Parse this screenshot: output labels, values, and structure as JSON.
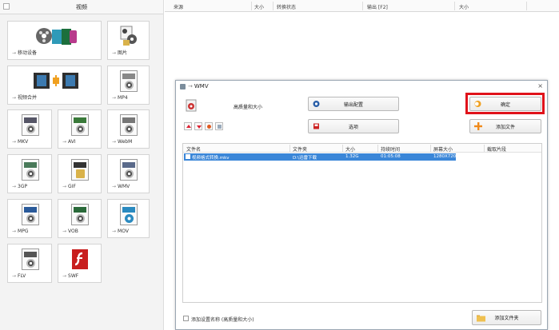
{
  "sidebar": {
    "header": "视频",
    "tiles": [
      {
        "label": "移动设备",
        "icon": "mobile-device-icon"
      },
      {
        "label": "图片",
        "icon": "picture-icon"
      },
      {
        "label": "视频合并",
        "icon": "video-join-icon"
      },
      {
        "label": "MP4",
        "icon": "mp4-file-icon"
      },
      {
        "label": "MKV",
        "icon": "mkv-file-icon"
      },
      {
        "label": "AVI",
        "icon": "avi-file-icon"
      },
      {
        "label": "WebM",
        "icon": "webm-file-icon"
      },
      {
        "label": "3GP",
        "icon": "3gp-file-icon"
      },
      {
        "label": "GIF",
        "icon": "gif-file-icon"
      },
      {
        "label": "WMV",
        "icon": "wmv-file-icon"
      },
      {
        "label": "MPG",
        "icon": "mpg-file-icon"
      },
      {
        "label": "VOB",
        "icon": "vob-file-icon"
      },
      {
        "label": "MOV",
        "icon": "mov-file-icon"
      },
      {
        "label": "FLV",
        "icon": "flv-file-icon"
      },
      {
        "label": "SWF",
        "icon": "swf-file-icon"
      }
    ]
  },
  "main_columns": [
    "来源",
    "大小",
    "转换状态",
    "输出 [F2]",
    "大小"
  ],
  "dialog": {
    "title": "WMV",
    "quality": "高质量和大小",
    "output_config": "输出配置",
    "options": "选项",
    "ok": "确定",
    "add_file": "添加文件",
    "add_folder": "添加文件夹",
    "table": {
      "headers": [
        "文件名",
        "文件夹",
        "大小",
        "持续时间",
        "屏幕大小",
        "截取片段"
      ],
      "rows": [
        {
          "name": "视频格式转换.mkv",
          "folder": "D:\\迅雷下载",
          "size": "1.32G",
          "duration": "01:05:08",
          "screen": "1280X720",
          "clip": ""
        }
      ]
    },
    "checkbox_label": "添加设置名称 (高质量和大小)"
  },
  "colors": {
    "accent_red": "#e0121a",
    "row_blue": "#3a86d8"
  }
}
